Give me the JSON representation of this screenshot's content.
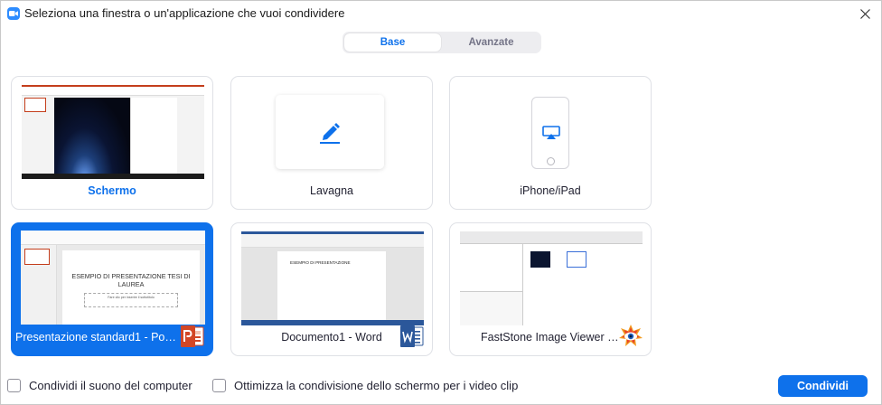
{
  "window": {
    "title": "Seleziona una finestra o un'applicazione che vuoi condividere",
    "app_icon": "zoom-camera-icon",
    "close_icon": "close-icon"
  },
  "tabs": [
    {
      "label": "Base",
      "selected": true
    },
    {
      "label": "Avanzate",
      "selected": false
    }
  ],
  "cards": [
    {
      "label": "Schermo",
      "kind": "screen",
      "highlighted": true
    },
    {
      "label": "Lavagna",
      "kind": "whiteboard",
      "icon": "pen-icon"
    },
    {
      "label": "iPhone/iPad",
      "kind": "device",
      "icon": "airplay-icon"
    },
    {
      "label": "Presentazione standard1 - Power...",
      "kind": "window",
      "app_icon": "powerpoint-icon",
      "selected": true,
      "thumb_title": "ESEMPIO DI PRESENTAZIONE TESI DI LAUREA",
      "thumb_sub": "Fare clic per inserire il sottotitolo"
    },
    {
      "label": "Documento1 - Word",
      "kind": "window",
      "app_icon": "word-icon",
      "thumb_text": "ESEMPIO DI PRESENTAZIONE"
    },
    {
      "label": "FastStone Image Viewer 7.0",
      "kind": "window",
      "app_icon": "faststone-icon"
    }
  ],
  "footer": {
    "share_sound_label": "Condividi il suono del computer",
    "share_sound_checked": false,
    "optimize_label": "Ottimizza la condivisione dello schermo per i video clip",
    "optimize_checked": false,
    "share_button": "Condividi"
  },
  "colors": {
    "accent": "#0e71eb",
    "powerpoint": "#d24726",
    "word": "#2b579a"
  }
}
